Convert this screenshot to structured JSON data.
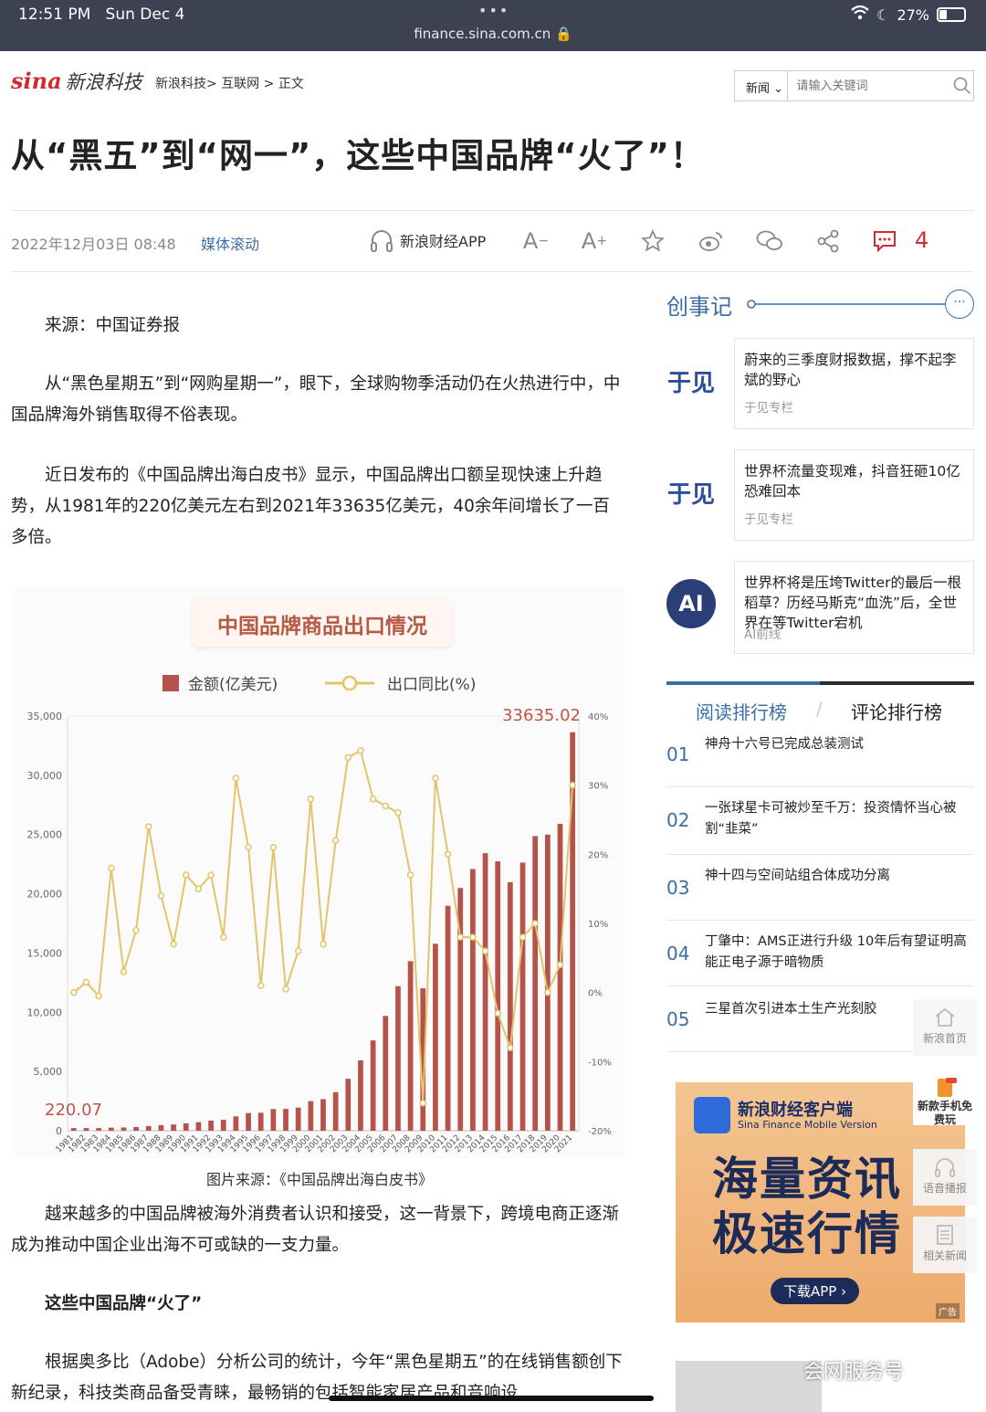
{
  "status": {
    "time": "12:51 PM",
    "day": "Sun Dec 4",
    "url": "finance.sina.com.cn",
    "battery": "27%"
  },
  "header": {
    "logo": "sina",
    "logo_cn": "新浪科技",
    "breadcrumb": [
      "新浪科技>",
      "互联网",
      ">",
      "正文"
    ],
    "search_select": "新闻",
    "search_placeholder": "请输入关键词"
  },
  "article": {
    "title": "从“黑五”到“网一”，这些中国品牌“火了”！",
    "date": "2022年12月03日 08:48",
    "source": "媒体滚动",
    "app_label": "新浪财经APP",
    "comment_count": "4",
    "paragraphs": [
      "来源：中国证券报",
      "从“黑色星期五”到“网购星期一”，眼下，全球购物季活动仍在火热进行中，中国品牌海外销售取得不俗表现。",
      "近日发布的《中国品牌出海白皮书》显示，中国品牌出口额呈现快速上升趋势，从1981年的220亿美元左右到2021年33635亿美元，40余年间增长了一百多倍。"
    ],
    "figure_caption": "图片来源：《中国品牌出海白皮书》",
    "paragraphs2": [
      "越来越多的中国品牌被海外消费者认识和接受，这一背景下，跨境电商正逐渐成为推动中国企业出海不可或缺的一支力量。"
    ],
    "subheading": "这些中国品牌“火了”",
    "paragraphs3": [
      "根据奥多比（Adobe）分析公司的统计，今年“黑色星期五”的在线销售额创下新纪录，科技类商品备受青睐，最畅销的包括智能家居产品和音响设"
    ]
  },
  "chart_data": {
    "type": "bar",
    "title": "中国品牌商品出口情况",
    "legend": [
      "金额(亿美元)",
      "出口同比(%)"
    ],
    "annotations": [
      "220.07",
      "33635.02"
    ],
    "categories": [
      "1981",
      "1982",
      "1983",
      "1984",
      "1985",
      "1986",
      "1987",
      "1988",
      "1989",
      "1990",
      "1991",
      "1992",
      "1993",
      "1994",
      "1995",
      "1996",
      "1997",
      "1998",
      "1999",
      "2000",
      "2001",
      "2002",
      "2003",
      "2004",
      "2005",
      "2006",
      "2007",
      "2008",
      "2009",
      "2010",
      "2011",
      "2012",
      "2013",
      "2014",
      "2015",
      "2016",
      "2017",
      "2018",
      "2019",
      "2020",
      "2021"
    ],
    "series": [
      {
        "name": "金额(亿美元)",
        "type": "bar",
        "axis": "left",
        "values": [
          220,
          223,
          222,
          261,
          274,
          309,
          394,
          475,
          525,
          621,
          719,
          849,
          917,
          1210,
          1488,
          1511,
          1828,
          1837,
          1949,
          2492,
          2661,
          3256,
          4382,
          5934,
          7620,
          9689,
          12201,
          14307,
          12016,
          15778,
          18984,
          20487,
          22090,
          23423,
          22735,
          20976,
          22633,
          24867,
          24995,
          25900,
          33635
        ]
      },
      {
        "name": "出口同比(%)",
        "type": "line",
        "axis": "right",
        "values": [
          0,
          1.5,
          -0.5,
          18,
          3,
          9,
          24,
          14,
          7,
          17,
          15,
          17,
          8,
          31,
          21,
          1,
          21,
          0.5,
          6,
          28,
          7,
          22,
          34,
          35,
          28,
          27,
          26,
          17,
          -16,
          31,
          20,
          8,
          8,
          6,
          -3,
          -8,
          8,
          10,
          0,
          4,
          30
        ]
      }
    ],
    "ylim_left": [
      0,
      35000
    ],
    "ylim_right": [
      -20,
      40
    ],
    "yticks_left": [
      "35,000",
      "30,000",
      "25,000",
      "20,000",
      "15,000",
      "10,000",
      "5,000",
      "0"
    ],
    "yticks_right": [
      "40%",
      "30%",
      "20%",
      "10%",
      "0%",
      "-10%",
      "-20%"
    ],
    "colors": {
      "bar": "#b5524a",
      "line": "#e3c46a"
    }
  },
  "sidebar": {
    "section_title": "创事记",
    "cards": [
      {
        "title": "蔚来的三季度财报数据，撑不起李斌的野心",
        "source": "于见专栏",
        "logo": "于见"
      },
      {
        "title": "世界杯流量变现难，抖音狂砸10亿恐难回本",
        "source": "于见专栏",
        "logo": "于见"
      },
      {
        "title": "世界杯将是压垮Twitter的最后一根稻草？历经马斯克“血洗”后，全世界在等Twitter宕机",
        "source": "AI前线",
        "logo": "AI"
      }
    ],
    "rank_tabs": [
      "阅读排行榜",
      "评论排行榜"
    ],
    "ranks": [
      {
        "num": "01",
        "text": "神舟十六号已完成总装测试"
      },
      {
        "num": "02",
        "text": "一张球星卡可被炒至千万：投资情怀当心被割“韭菜”"
      },
      {
        "num": "03",
        "text": "神十四与空间站组合体成功分离"
      },
      {
        "num": "04",
        "text": "丁肇中：AMS正进行升级 10年后有望证明高能正电子源于暗物质"
      },
      {
        "num": "05",
        "text": "三星首次引进本土生产光刻胶"
      }
    ],
    "float_buttons": [
      "新浪首页",
      "新款手机免费玩",
      "语音播报",
      "相关新闻"
    ],
    "ad": {
      "head": "新浪财经客户端",
      "sub": "Sina Finance Mobile Version",
      "line1": "海量资讯",
      "line2": "极速行情",
      "button": "下载APP",
      "tag": "广告"
    },
    "watermark": "会网服务号"
  }
}
